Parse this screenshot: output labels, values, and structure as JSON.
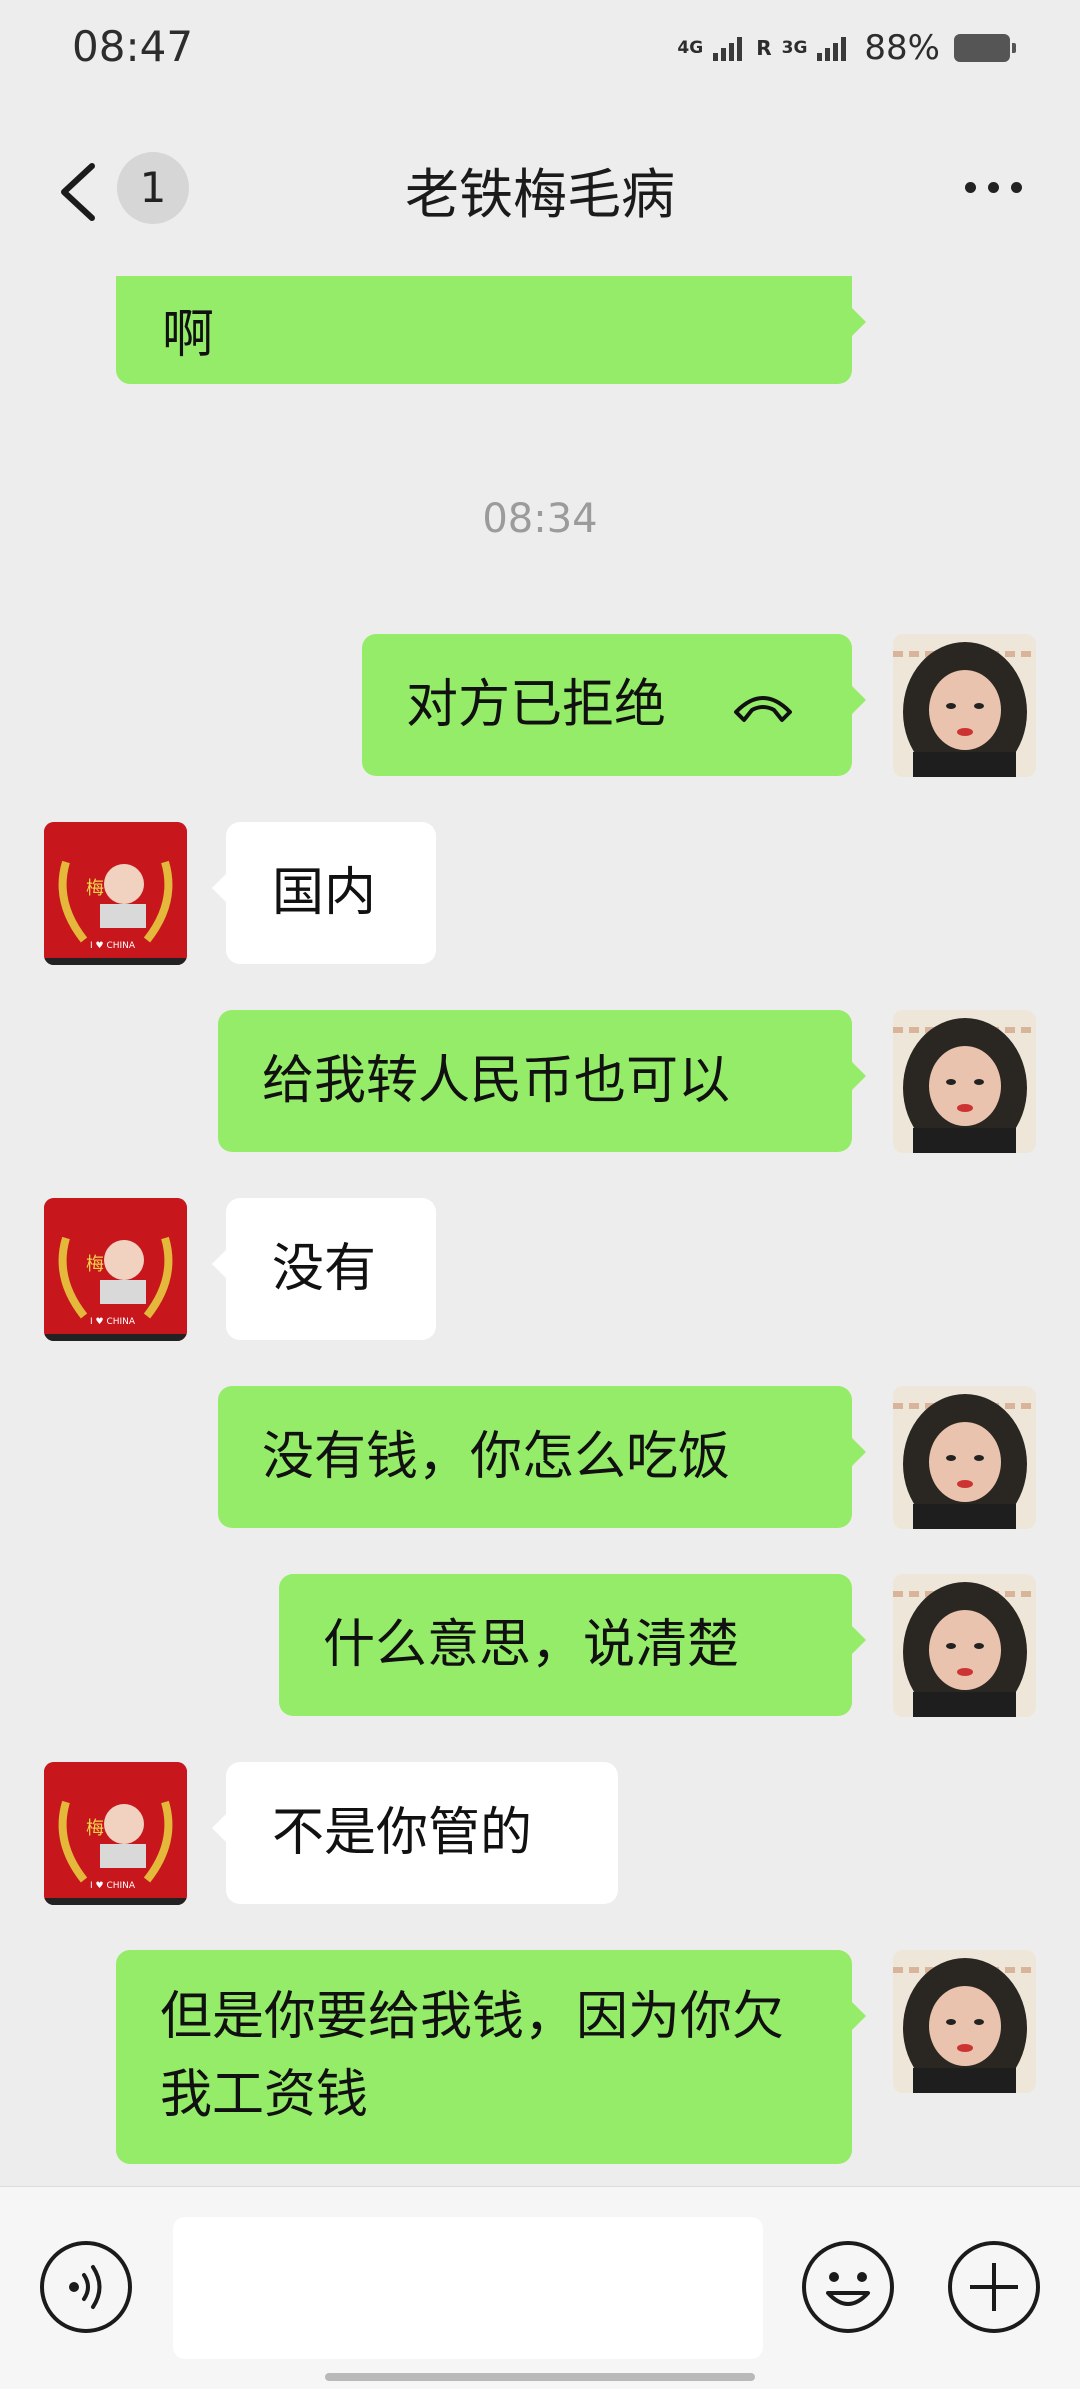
{
  "status_bar": {
    "time": "08:47",
    "network_1": "4G",
    "roaming": "R",
    "network_2": "3G",
    "battery": "88%",
    "battery_level": 0.88
  },
  "header": {
    "unread_count": "1",
    "title": "老铁梅毛病"
  },
  "messages": [
    {
      "side": "out",
      "text": "啊"
    },
    {
      "type": "time",
      "text": "08:34"
    },
    {
      "side": "out",
      "text": "对方已拒绝",
      "icon": "call-declined-icon"
    },
    {
      "side": "in",
      "text": "国内"
    },
    {
      "side": "out",
      "text": "给我转人民币也可以"
    },
    {
      "side": "in",
      "text": "没有"
    },
    {
      "side": "out",
      "text": "没有钱，你怎么吃饭"
    },
    {
      "side": "out",
      "text": "什么意思，说清楚"
    },
    {
      "side": "in",
      "text": "不是你管的"
    },
    {
      "side": "out",
      "text": "但是你要给我钱，因为你欠我工资钱"
    }
  ],
  "avatar_other_caption": "I ♥ CHINA",
  "avatar_other_banner": "梅",
  "colors": {
    "outgoing_bubble": "#95ec69",
    "incoming_bubble": "#ffffff",
    "background": "#ededed"
  },
  "input_bar": {
    "icons": [
      "voice-icon",
      "emoji-icon",
      "plus-icon"
    ]
  }
}
